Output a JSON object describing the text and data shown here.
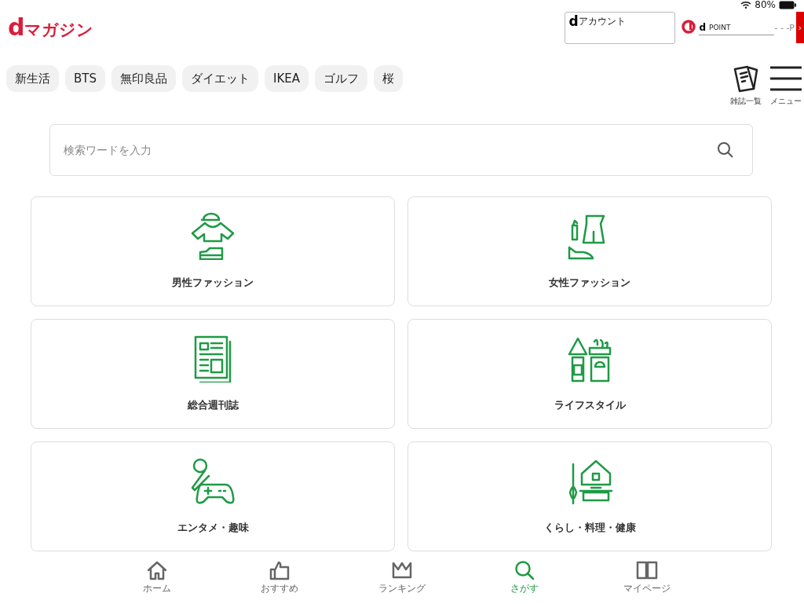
{
  "status_bar": {
    "battery": "80%"
  },
  "header": {
    "logo_mark": "d",
    "logo_text": "マガジン",
    "account": {
      "mark": "d",
      "label": "アカウント"
    },
    "dpoint": {
      "mark": "d",
      "label": "POINT",
      "value": "- - -P",
      "arrow": "›"
    }
  },
  "tags": [
    "新生活",
    "BTS",
    "無印良品",
    "ダイエット",
    "IKEA",
    "ゴルフ",
    "桜"
  ],
  "header_actions": [
    {
      "label": "雑誌一覧"
    },
    {
      "label": "メニュー"
    }
  ],
  "search": {
    "placeholder": "検索ワードを入力"
  },
  "categories": [
    {
      "label": "男性ファッション"
    },
    {
      "label": "女性ファッション"
    },
    {
      "label": "総合週刊誌"
    },
    {
      "label": "ライフスタイル"
    },
    {
      "label": "エンタメ・趣味"
    },
    {
      "label": "くらし・料理・健康"
    }
  ],
  "bottom_nav": [
    {
      "label": "ホーム",
      "selected": false
    },
    {
      "label": "おすすめ",
      "selected": false
    },
    {
      "label": "ランキング",
      "selected": false
    },
    {
      "label": "さがす",
      "selected": true
    },
    {
      "label": "マイページ",
      "selected": false
    }
  ]
}
